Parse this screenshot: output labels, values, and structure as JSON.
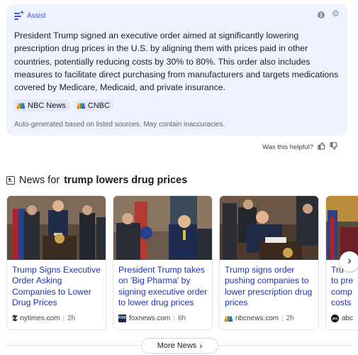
{
  "assist": {
    "title": "Assist",
    "summary": "President Trump signed an executive order aimed at significantly lowering prescription drug prices in the U.S. by aligning them with prices paid in other countries, potentially reducing costs by 30% to 80%. This order also includes measures to facilitate direct purchasing from manufacturers and targets medications covered by Medicare, Medicaid, and private insurance.",
    "sources": [
      {
        "label": "NBC News",
        "icon": "nbc-peacock-icon"
      },
      {
        "label": "CNBC",
        "icon": "nbc-peacock-icon"
      }
    ],
    "disclaimer": "Auto-generated based on listed sources. May contain inaccuracies.",
    "icons": {
      "info": "info-icon",
      "settings": "gear-icon"
    }
  },
  "feedback": {
    "label": "Was this helpful?",
    "thumbs_up": "👍",
    "thumbs_down": "👎"
  },
  "news": {
    "prefix": "News for",
    "query": "trump lowers drug prices",
    "cards": [
      {
        "headline": "Trump Signs Executive Order Asking Companies to Lower Drug Prices",
        "source": "nytimes.com",
        "age": "2h",
        "logo": "nyt-logo"
      },
      {
        "headline": "President Trump takes on 'Big Pharma' by signing executive order to lower drug prices",
        "source": "foxnews.com",
        "age": "6h",
        "logo": "fox-logo"
      },
      {
        "headline": "Trump signs order pushing companies to lower prescription drug prices",
        "source": "nbcnews.com",
        "age": "2h",
        "logo": "nbc-logo"
      },
      {
        "headline": "Trump ... to pre... comp... costs",
        "source": "abc",
        "age": "",
        "logo": "abc-logo"
      }
    ],
    "more_label": "More News"
  },
  "colors": {
    "accent": "#3d4fd6",
    "link": "#1f33b8",
    "assist_bg": "#eef3fd"
  }
}
